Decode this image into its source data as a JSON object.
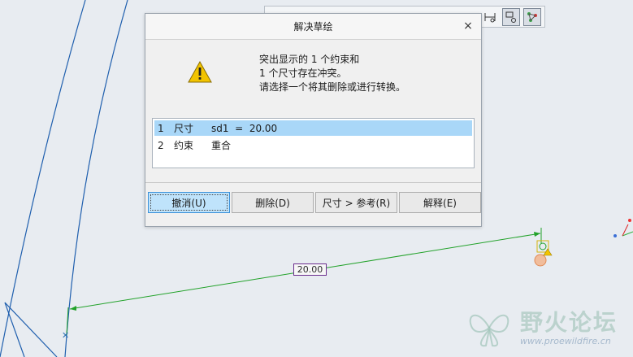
{
  "dialog": {
    "title": "解决草绘",
    "close_glyph": "×",
    "message": [
      "突出显示的 1 个约束和",
      "1 个尺寸存在冲突。",
      "请选择一个将其删除或进行转换。"
    ],
    "items": [
      {
        "num": "1",
        "type": "尺寸",
        "detail": "sd1  =  20.00"
      },
      {
        "num": "2",
        "type": "约束",
        "detail": "重合"
      }
    ],
    "buttons": {
      "undo": "撤消(U)",
      "delete": "删除(D)",
      "dim_to_ref": "尺寸 > 参考(R)",
      "explain": "解释(E)"
    }
  },
  "sketch": {
    "dimension_value": "20.00"
  },
  "watermark": {
    "title": "野火论坛",
    "url": "www.proewildfire.cn"
  },
  "colors": {
    "canvas_bg": "#e8ecf1",
    "sketch_line": "#1f5fae",
    "dimension_line": "#22a22a",
    "selection": "#a9d7f8",
    "primary_button": "#bfe3fb"
  }
}
